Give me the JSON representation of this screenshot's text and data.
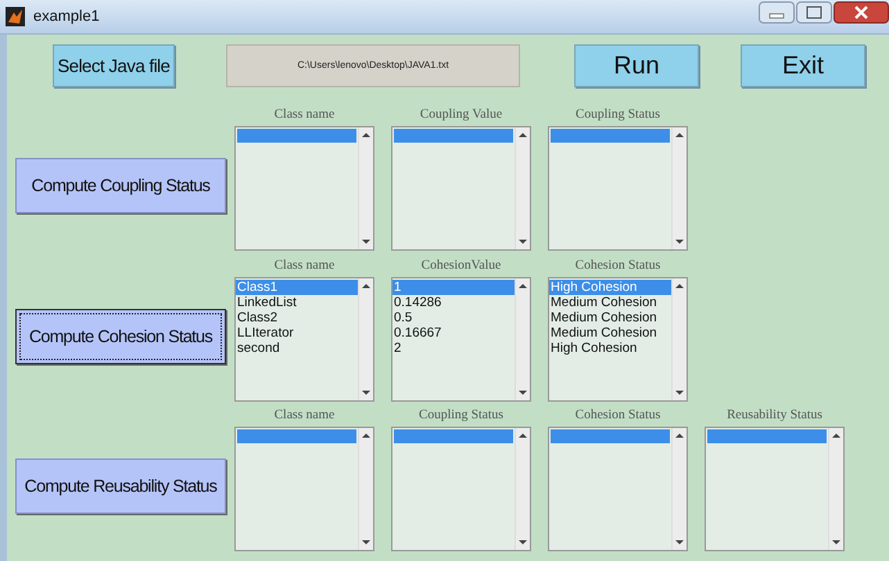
{
  "window": {
    "title": "example1"
  },
  "toolbar": {
    "select_button": "Select Java file",
    "file_path": "C:\\Users\\lenovo\\Desktop\\JAVA1.txt",
    "run_button": "Run",
    "exit_button": "Exit"
  },
  "sections": [
    {
      "button": "Compute Coupling Status",
      "focused": false,
      "lists": [
        {
          "heading": "Class name"
        },
        {
          "heading": "Coupling Value"
        },
        {
          "heading": "Coupling Status"
        }
      ]
    },
    {
      "button": "Compute Cohesion Status",
      "focused": true,
      "lists": [
        {
          "heading": "Class name",
          "items": [
            {
              "text": "Class1",
              "selected": true
            },
            {
              "text": "LinkedList",
              "selected": false
            },
            {
              "text": "Class2",
              "selected": false
            },
            {
              "text": "LLIterator",
              "selected": false
            },
            {
              "text": "second",
              "selected": false
            }
          ]
        },
        {
          "heading": "CohesionValue",
          "items": [
            {
              "text": "1",
              "selected": true
            },
            {
              "text": "0.14286",
              "selected": false
            },
            {
              "text": "0.5",
              "selected": false
            },
            {
              "text": "0.16667",
              "selected": false
            },
            {
              "text": "2",
              "selected": false
            }
          ]
        },
        {
          "heading": "Cohesion Status",
          "items": [
            {
              "text": "High Cohesion",
              "selected": true
            },
            {
              "text": "Medium Cohesion",
              "selected": false
            },
            {
              "text": "Medium Cohesion",
              "selected": false
            },
            {
              "text": "Medium Cohesion",
              "selected": false
            },
            {
              "text": "High Cohesion",
              "selected": false
            }
          ]
        }
      ]
    },
    {
      "button": "Compute Reusability Status",
      "focused": false,
      "lists": [
        {
          "heading": "Class name"
        },
        {
          "heading": "Coupling Status"
        },
        {
          "heading": "Cohesion Status"
        },
        {
          "heading": "Reusability Status"
        }
      ]
    }
  ]
}
